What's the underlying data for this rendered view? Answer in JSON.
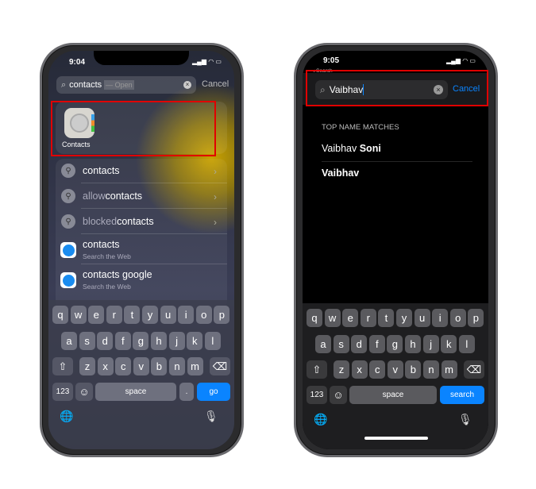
{
  "left": {
    "time": "9:04",
    "search": {
      "value": "contacts",
      "suggestion": "— Open",
      "cancel": "Cancel"
    },
    "app": {
      "name": "Contacts",
      "icon": "contacts-app-icon"
    },
    "results": [
      {
        "dim": "",
        "bold": "contacts",
        "type": "search"
      },
      {
        "dim": "allow ",
        "bold": "contacts",
        "type": "search"
      },
      {
        "dim": "blocked ",
        "bold": "contacts",
        "type": "search"
      }
    ],
    "web": [
      {
        "title": "contacts",
        "sub": "Search the Web"
      },
      {
        "title": "contacts google",
        "sub": "Search the Web"
      }
    ],
    "keyboard": {
      "space": "space",
      "go": "go",
      "num": "123",
      "period": "."
    }
  },
  "right": {
    "time": "9:05",
    "back": "◂ Search",
    "search": {
      "value": "Vaibhav",
      "cancel": "Cancel"
    },
    "section": "TOP NAME MATCHES",
    "matches": [
      {
        "normal": "Vaibhav ",
        "bold": "Soni"
      },
      {
        "normal": "",
        "bold": "Vaibhav"
      }
    ],
    "keyboard": {
      "space": "space",
      "go": "search",
      "num": "123"
    }
  },
  "keys": {
    "row1": [
      "q",
      "w",
      "e",
      "r",
      "t",
      "y",
      "u",
      "i",
      "o",
      "p"
    ],
    "row2": [
      "a",
      "s",
      "d",
      "f",
      "g",
      "h",
      "j",
      "k",
      "l"
    ],
    "row3": [
      "z",
      "x",
      "c",
      "v",
      "b",
      "n",
      "m"
    ]
  },
  "colors": {
    "accent": "#0a84ff",
    "highlight": "#e00000"
  }
}
